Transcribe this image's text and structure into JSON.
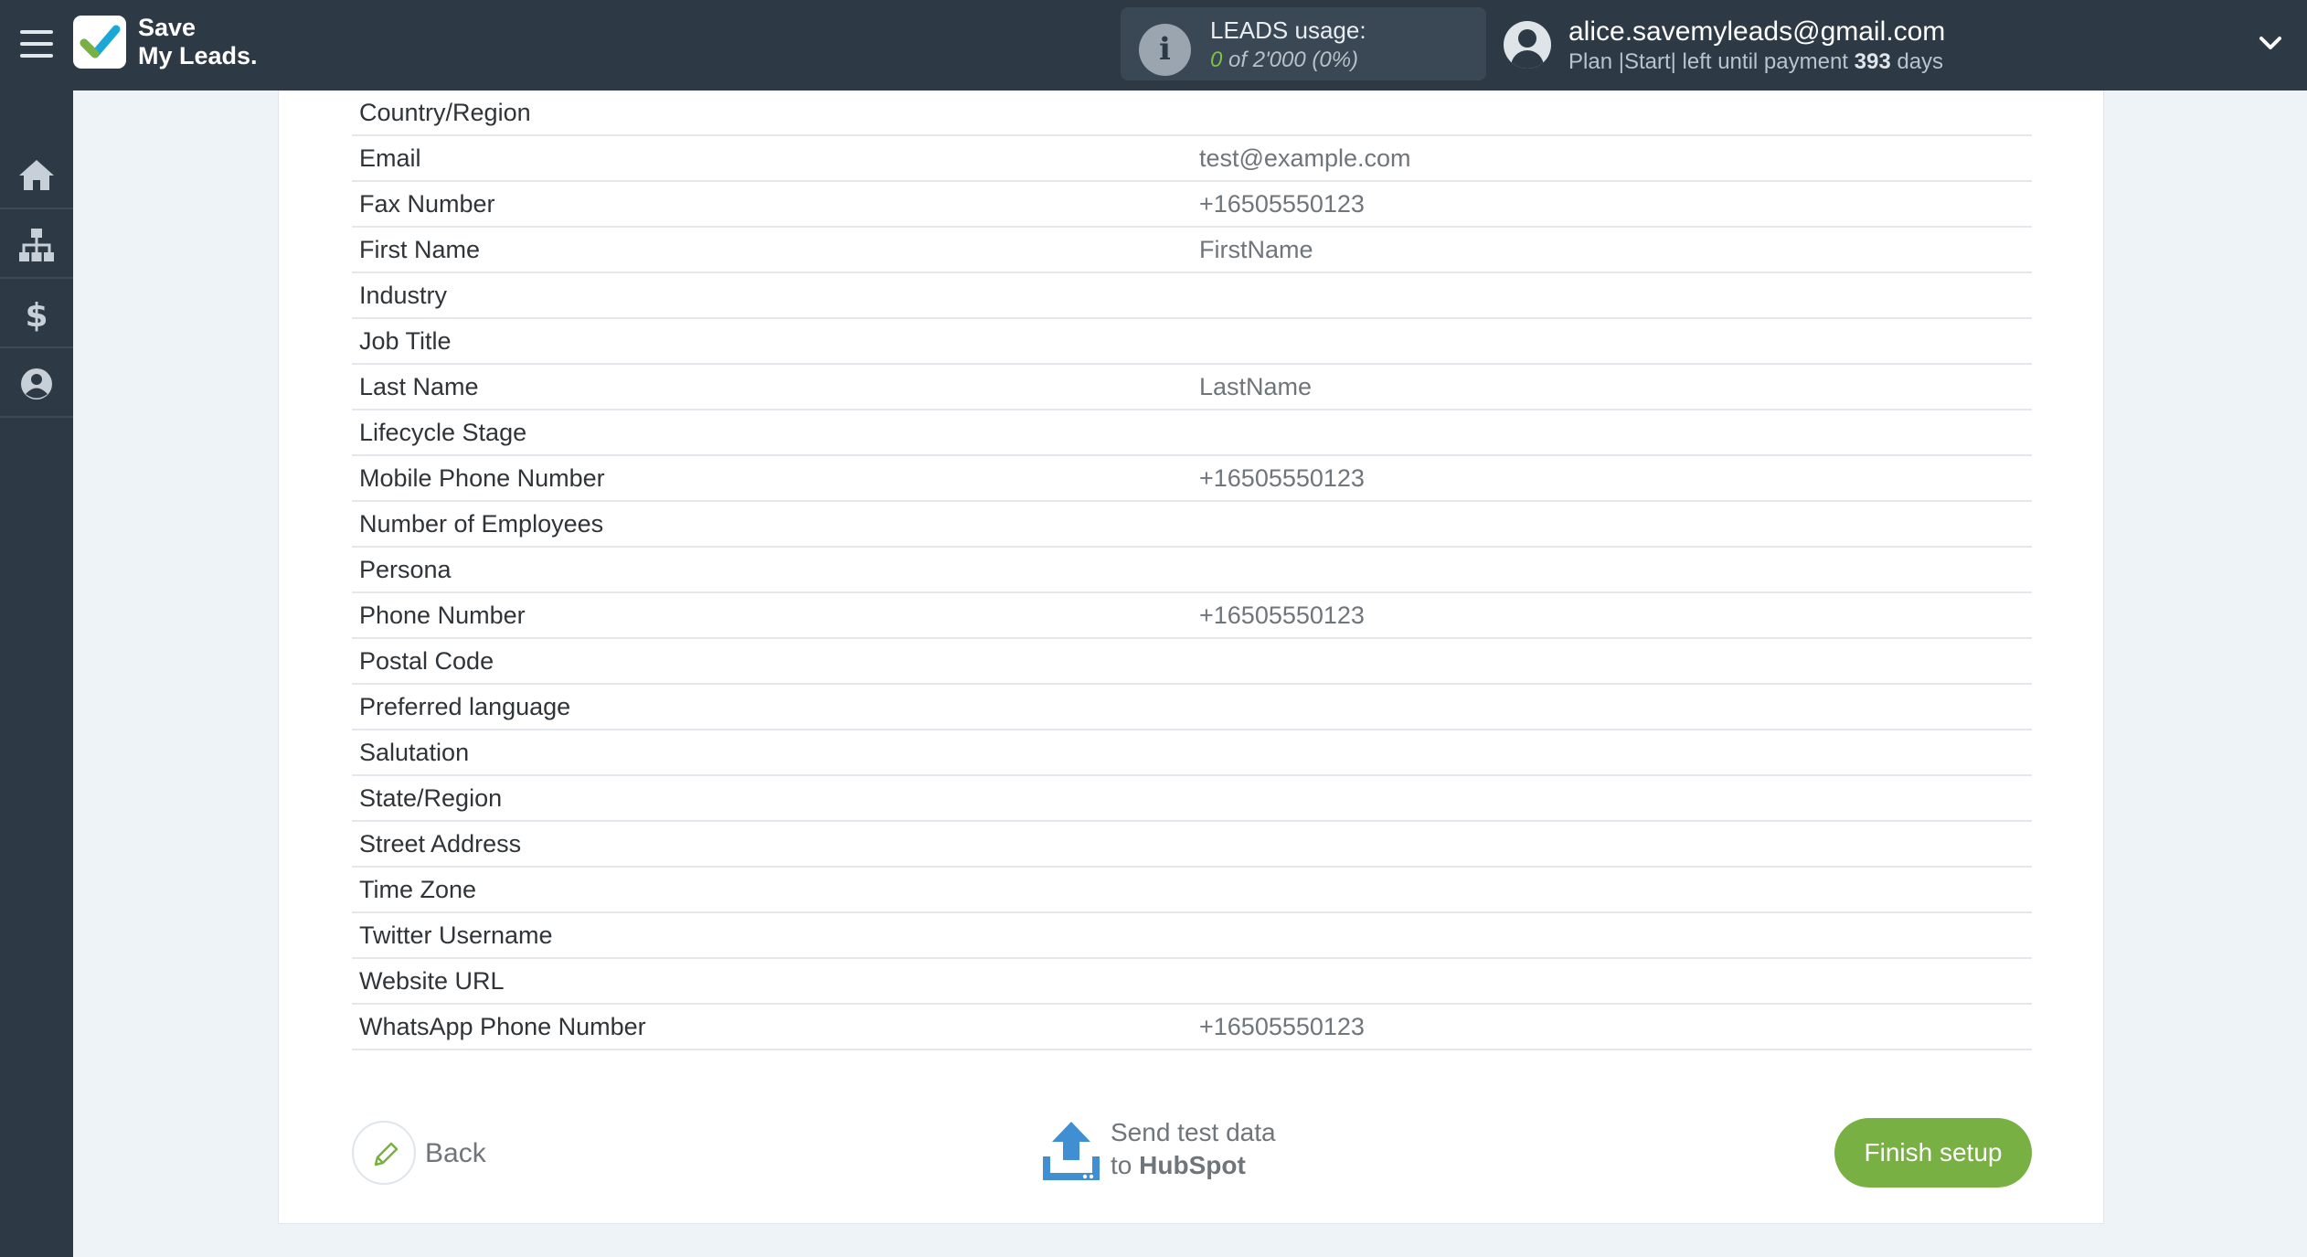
{
  "app": {
    "logo_line1": "Save",
    "logo_line2": "My Leads.",
    "logo_check_color": "#1ba8d6",
    "brand_green": "#78b043",
    "header_bg": "#2d3a46"
  },
  "usage": {
    "title": "LEADS usage:",
    "used": "0",
    "rest": "of 2'000 (0%)"
  },
  "account": {
    "email": "alice.savemyleads@gmail.com",
    "plan_prefix": "Plan |Start| left until payment",
    "days": "393",
    "days_suffix": "days"
  },
  "sidebar": {
    "items": [
      {
        "name": "home",
        "icon": "home-icon"
      },
      {
        "name": "integrations",
        "icon": "sitemap-icon"
      },
      {
        "name": "billing",
        "icon": "dollar-icon"
      },
      {
        "name": "profile",
        "icon": "user-circle-icon"
      }
    ]
  },
  "fields": [
    {
      "label": "Country/Region",
      "value": ""
    },
    {
      "label": "Email",
      "value": "test@example.com"
    },
    {
      "label": "Fax Number",
      "value": "+16505550123"
    },
    {
      "label": "First Name",
      "value": "FirstName"
    },
    {
      "label": "Industry",
      "value": ""
    },
    {
      "label": "Job Title",
      "value": ""
    },
    {
      "label": "Last Name",
      "value": "LastName"
    },
    {
      "label": "Lifecycle Stage",
      "value": ""
    },
    {
      "label": "Mobile Phone Number",
      "value": "+16505550123"
    },
    {
      "label": "Number of Employees",
      "value": ""
    },
    {
      "label": "Persona",
      "value": ""
    },
    {
      "label": "Phone Number",
      "value": "+16505550123"
    },
    {
      "label": "Postal Code",
      "value": ""
    },
    {
      "label": "Preferred language",
      "value": ""
    },
    {
      "label": "Salutation",
      "value": ""
    },
    {
      "label": "State/Region",
      "value": ""
    },
    {
      "label": "Street Address",
      "value": ""
    },
    {
      "label": "Time Zone",
      "value": ""
    },
    {
      "label": "Twitter Username",
      "value": ""
    },
    {
      "label": "Website URL",
      "value": ""
    },
    {
      "label": "WhatsApp Phone Number",
      "value": "+16505550123"
    }
  ],
  "actions": {
    "back_label": "Back",
    "send_line1": "Send test data",
    "send_to": "to",
    "send_target": "HubSpot",
    "finish_label": "Finish setup"
  }
}
